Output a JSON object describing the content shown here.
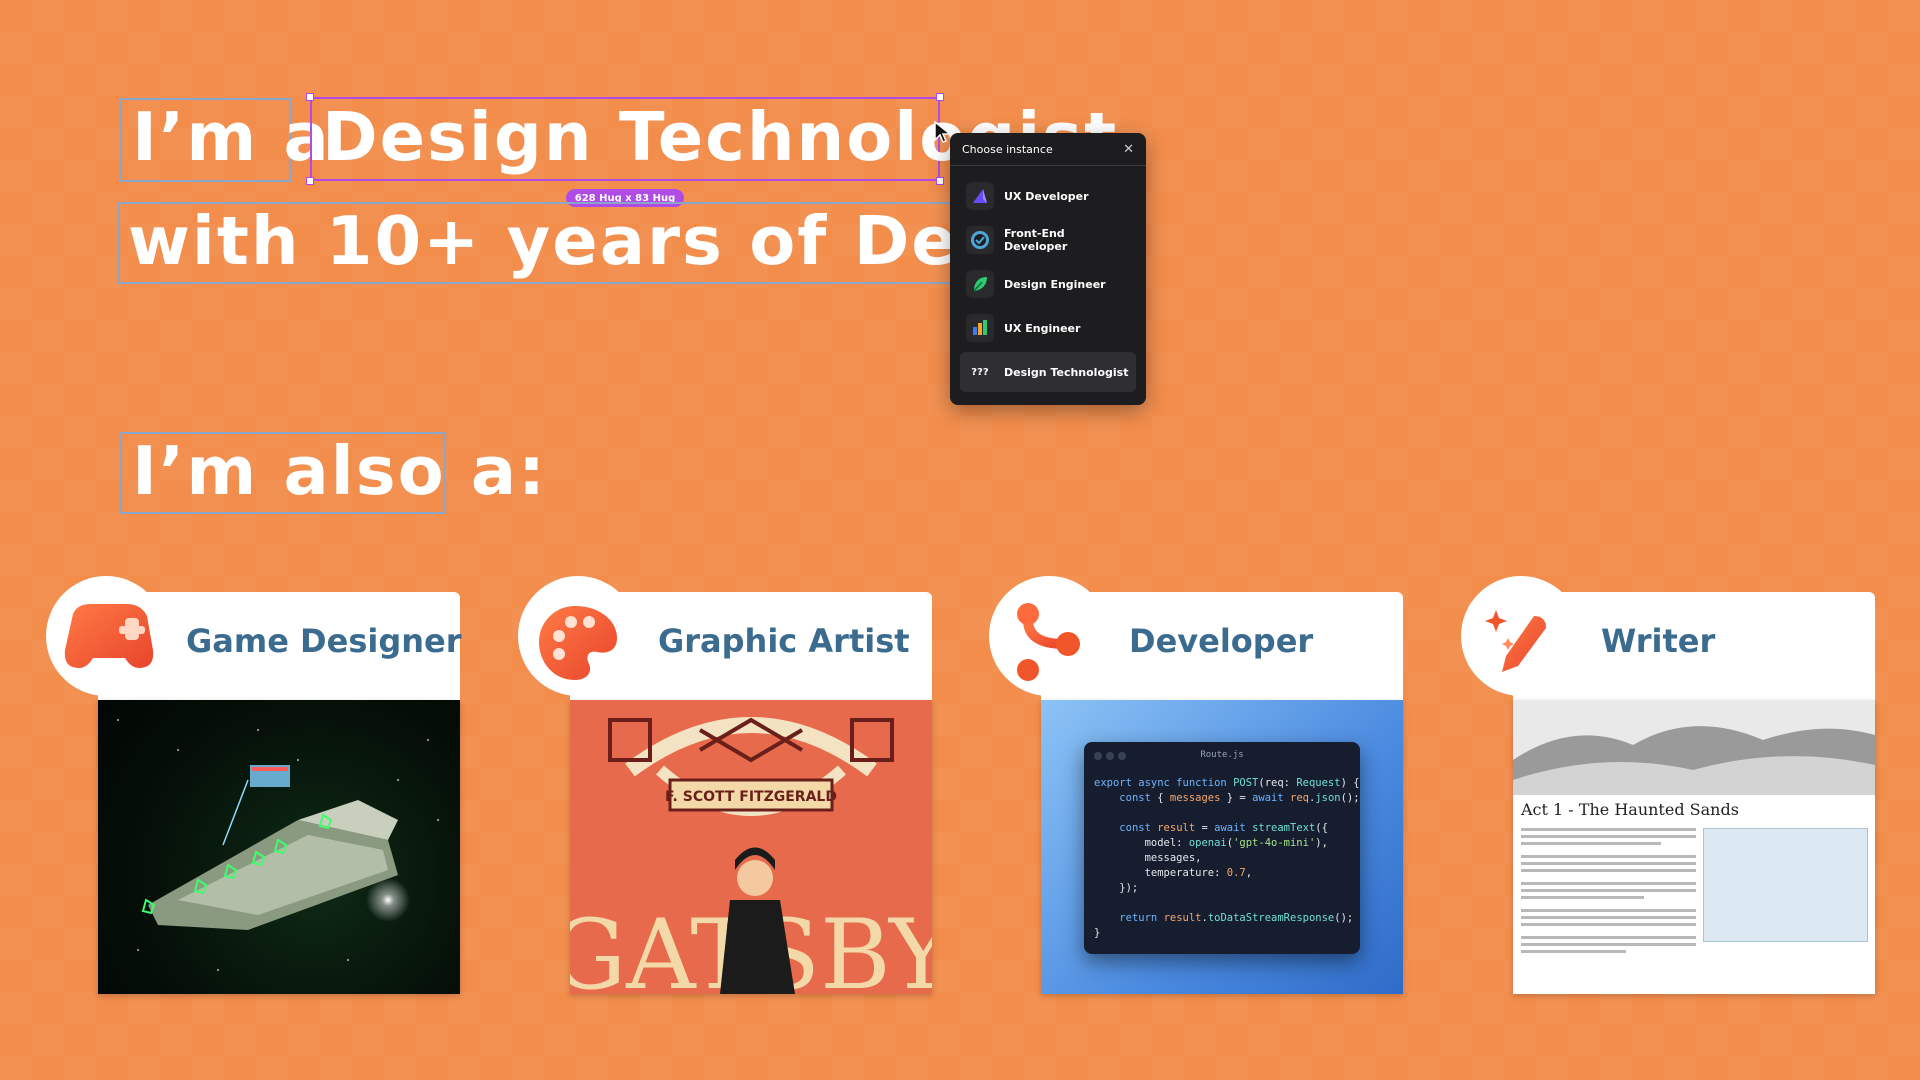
{
  "hero": {
    "line1_prefix": "I’m a",
    "line1_role": "Design Technologist",
    "line2": "with 10+ years of Design Sy",
    "size_badge": "628 Hug x 83 Hug",
    "also": "I’m also a:"
  },
  "instance_popup": {
    "title": "Choose instance",
    "items": [
      {
        "label": "UX Developer",
        "icon": "ux-developer-logo"
      },
      {
        "label": "Front-End Developer",
        "icon": "front-end-logo"
      },
      {
        "label": "Design Engineer",
        "icon": "leaf-logo"
      },
      {
        "label": "UX Engineer",
        "icon": "bar-chart-logo"
      },
      {
        "label": "Design Technologist",
        "icon_text": "???",
        "selected": true
      }
    ]
  },
  "cards": [
    {
      "title": "Game Designer",
      "icon": "gamepad-icon"
    },
    {
      "title": "Graphic Artist",
      "icon": "palette-icon"
    },
    {
      "title": "Developer",
      "icon": "git-branch-icon"
    },
    {
      "title": "Writer",
      "icon": "pen-sparkle-icon"
    }
  ],
  "gatsby": {
    "author": "F. SCOTT FITZGERALD",
    "title": "GATSBY"
  },
  "code": {
    "filename": "Route.js"
  },
  "writer_doc": {
    "heading": "Act 1 - The Haunted Sands"
  },
  "colors": {
    "background": "#f28d4c",
    "card_title": "#3b6b8e",
    "accent": "#f0562a",
    "selection": "#b14be6"
  }
}
